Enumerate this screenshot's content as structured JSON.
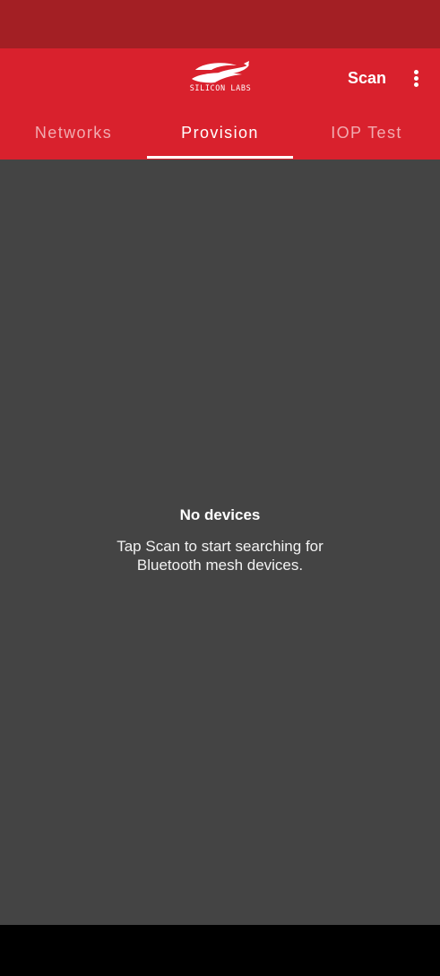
{
  "colors": {
    "status_bar": "#a31f24",
    "app_bar": "#d9212d",
    "content_bg": "#444444",
    "nav_bar": "#000000"
  },
  "header": {
    "logo_text": "SILICON LABS",
    "scan_label": "Scan",
    "more_icon": "more-vert-icon"
  },
  "tabs": [
    {
      "label": "Networks",
      "active": false
    },
    {
      "label": "Provision",
      "active": true
    },
    {
      "label": "IOP Test",
      "active": false
    }
  ],
  "empty_state": {
    "title": "No devices",
    "message": "Tap Scan to start searching for Bluetooth mesh devices."
  }
}
